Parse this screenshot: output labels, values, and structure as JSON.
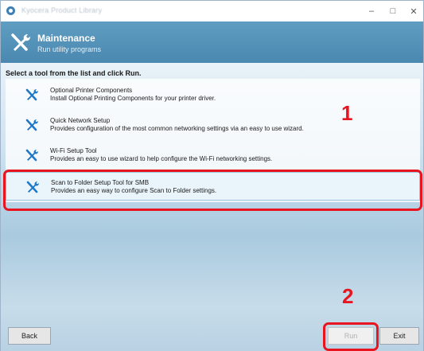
{
  "window": {
    "title": "Kyocera Product Library"
  },
  "header": {
    "title": "Maintenance",
    "subtitle": "Run utility programs"
  },
  "main": {
    "instruction": "Select a tool from the list and click Run.",
    "tools": [
      {
        "title": "Optional Printer Components",
        "description": "Install Optional Printing Components for your printer driver."
      },
      {
        "title": "Quick Network Setup",
        "description": "Provides configuration of the most common networking settings via an easy to use wizard."
      },
      {
        "title": "Wi-Fi Setup Tool",
        "description": "Provides an easy to use wizard to help configure the Wi-Fi networking settings."
      },
      {
        "title": "Scan to Folder Setup Tool for SMB",
        "description": "Provides an easy way to configure Scan to Folder settings."
      }
    ],
    "selected_index": 3
  },
  "callouts": {
    "step1": "1",
    "step2": "2"
  },
  "footer": {
    "back": "Back",
    "run": "Run",
    "exit": "Exit"
  },
  "colors": {
    "header": "#4a88b0",
    "highlight": "#e8151f",
    "tool_icon": "#1f78c8"
  },
  "icons": {
    "tool": "wrench-screwdriver-icon"
  }
}
